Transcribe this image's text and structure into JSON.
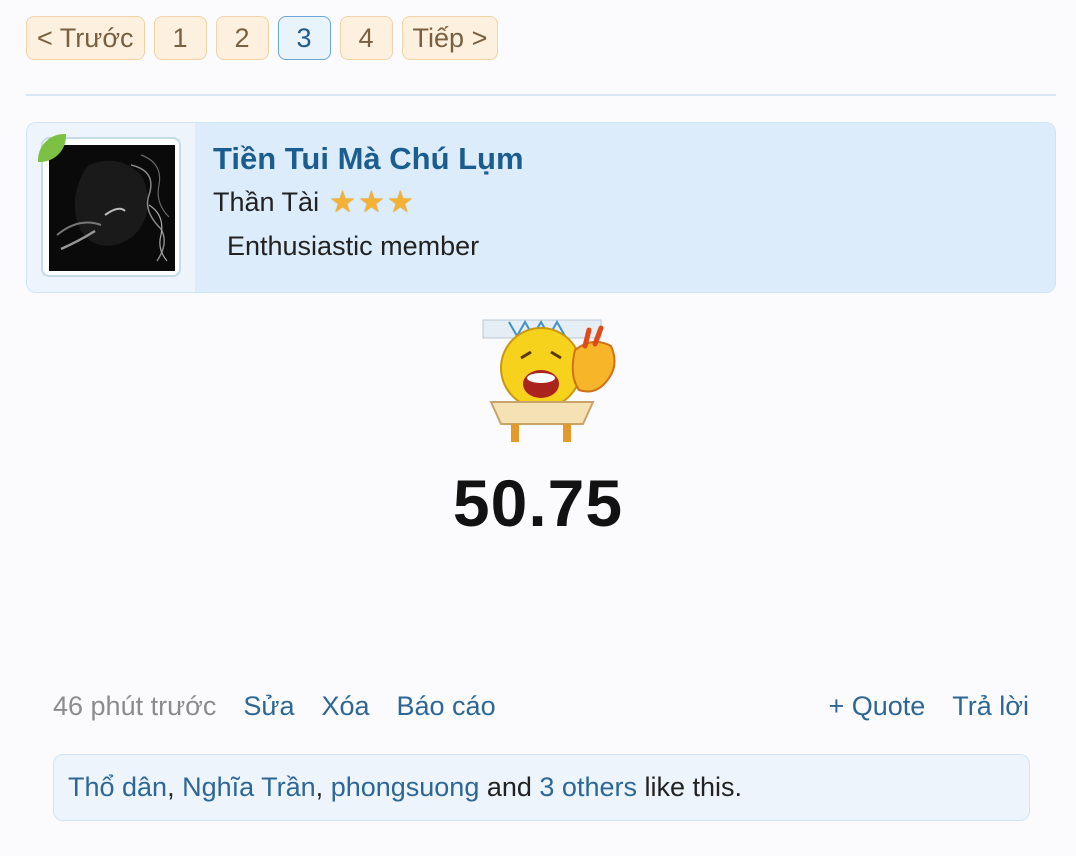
{
  "pagination": {
    "prev_label": "< Trước",
    "pages": [
      "1",
      "2",
      "3",
      "4"
    ],
    "current_page": "3",
    "next_label": "Tiếp >"
  },
  "post": {
    "author": {
      "username": "Tiền Tui Mà Chú Lụm",
      "title": "Thần Tài",
      "stars": 3,
      "status": "Enthusiastic member"
    },
    "content_value": "50.75",
    "meta": {
      "time": "46 phút trước",
      "edit_label": "Sửa",
      "delete_label": "Xóa",
      "report_label": "Báo cáo",
      "quote_label": "+ Quote",
      "reply_label": "Trả lời"
    },
    "likes": {
      "users": [
        "Thổ dân",
        "Nghĩa Trần",
        "phongsuong"
      ],
      "sep": ", ",
      "and_text": " and ",
      "others_label": "3 others",
      "suffix": " like this."
    }
  }
}
